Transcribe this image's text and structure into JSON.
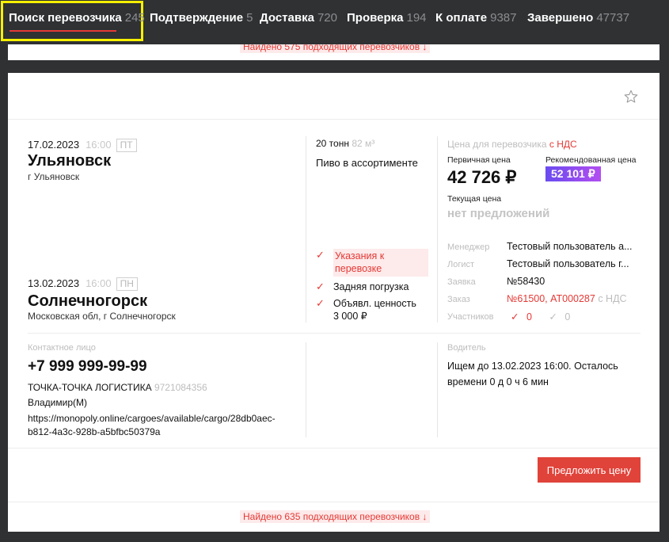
{
  "tabs": [
    {
      "label": "Поиск перевозчика",
      "count": "245"
    },
    {
      "label": "Подтверждение",
      "count": "5"
    },
    {
      "label": "Доставка",
      "count": "720"
    },
    {
      "label": "Проверка",
      "count": "194"
    },
    {
      "label": "К оплате",
      "count": "9387"
    },
    {
      "label": "Завершено",
      "count": "47737"
    }
  ],
  "prev_card": {
    "found_text": "Найдено 575 подходящих перевозчиков ↓"
  },
  "card": {
    "route": {
      "from": {
        "date": "17.02.2023",
        "time": "16:00",
        "dow": "ПТ",
        "city": "Ульяновск",
        "region": "г Ульяновск"
      },
      "to": {
        "date": "13.02.2023",
        "time": "16:00",
        "dow": "ПН",
        "city": "Солнечногорск",
        "region": "Московская обл, г Солнечногорск"
      }
    },
    "cargo": {
      "weight": "20 тонн",
      "volume": "82 м³",
      "name": "Пиво в ассортименте",
      "requirements": [
        "Указания к перевозке",
        "Задняя погрузка",
        "Объявл. ценность 3 000 ₽"
      ]
    },
    "price": {
      "header": "Цена для перевозчика",
      "vat": "с НДС",
      "initial_label": "Первичная цена",
      "initial_value": "42 726 ₽",
      "recommended_label": "Рекомендованная цена",
      "recommended_value": "52 101 ₽",
      "current_label": "Текущая цена",
      "current_value": "нет предложений"
    },
    "meta": {
      "manager_label": "Менеджер",
      "manager_value": "Тестовый пользователь а...",
      "logist_label": "Логист",
      "logist_value": "Тестовый пользователь г...",
      "request_label": "Заявка",
      "request_value": "№58430",
      "order_label": "Заказ",
      "order_value": "№61500, АТ000287",
      "order_vat": "с НДС",
      "participants_label": "Участников",
      "participants_checked": "0",
      "participants_other": "0"
    },
    "contact": {
      "label": "Контактное лицо",
      "phone": "+7 999 999-99-99",
      "company": "ТОЧКА-ТОЧКА ЛОГИСТИКА",
      "inn": "9721084356",
      "person": "Владимир(М)",
      "url_line1": "https://monopoly.online/cargoes/available/cargo/28db0aec-",
      "url_line2": "b812-4a3c-928b-a5bfbc50379a"
    },
    "driver": {
      "label": "Водитель",
      "text": "Ищем до 13.02.2023 16:00. Осталось времени 0 д 0 ч 6 мин"
    },
    "offer_button": "Предложить цену",
    "found_text": "Найдено 635 подходящих перевозчиков ↓"
  },
  "colors": {
    "accent": "#e53935",
    "active_frame": "#f5f000",
    "background": "#2f3133"
  },
  "icons": {
    "favorite": "star-outline-icon",
    "check": "check-icon"
  }
}
